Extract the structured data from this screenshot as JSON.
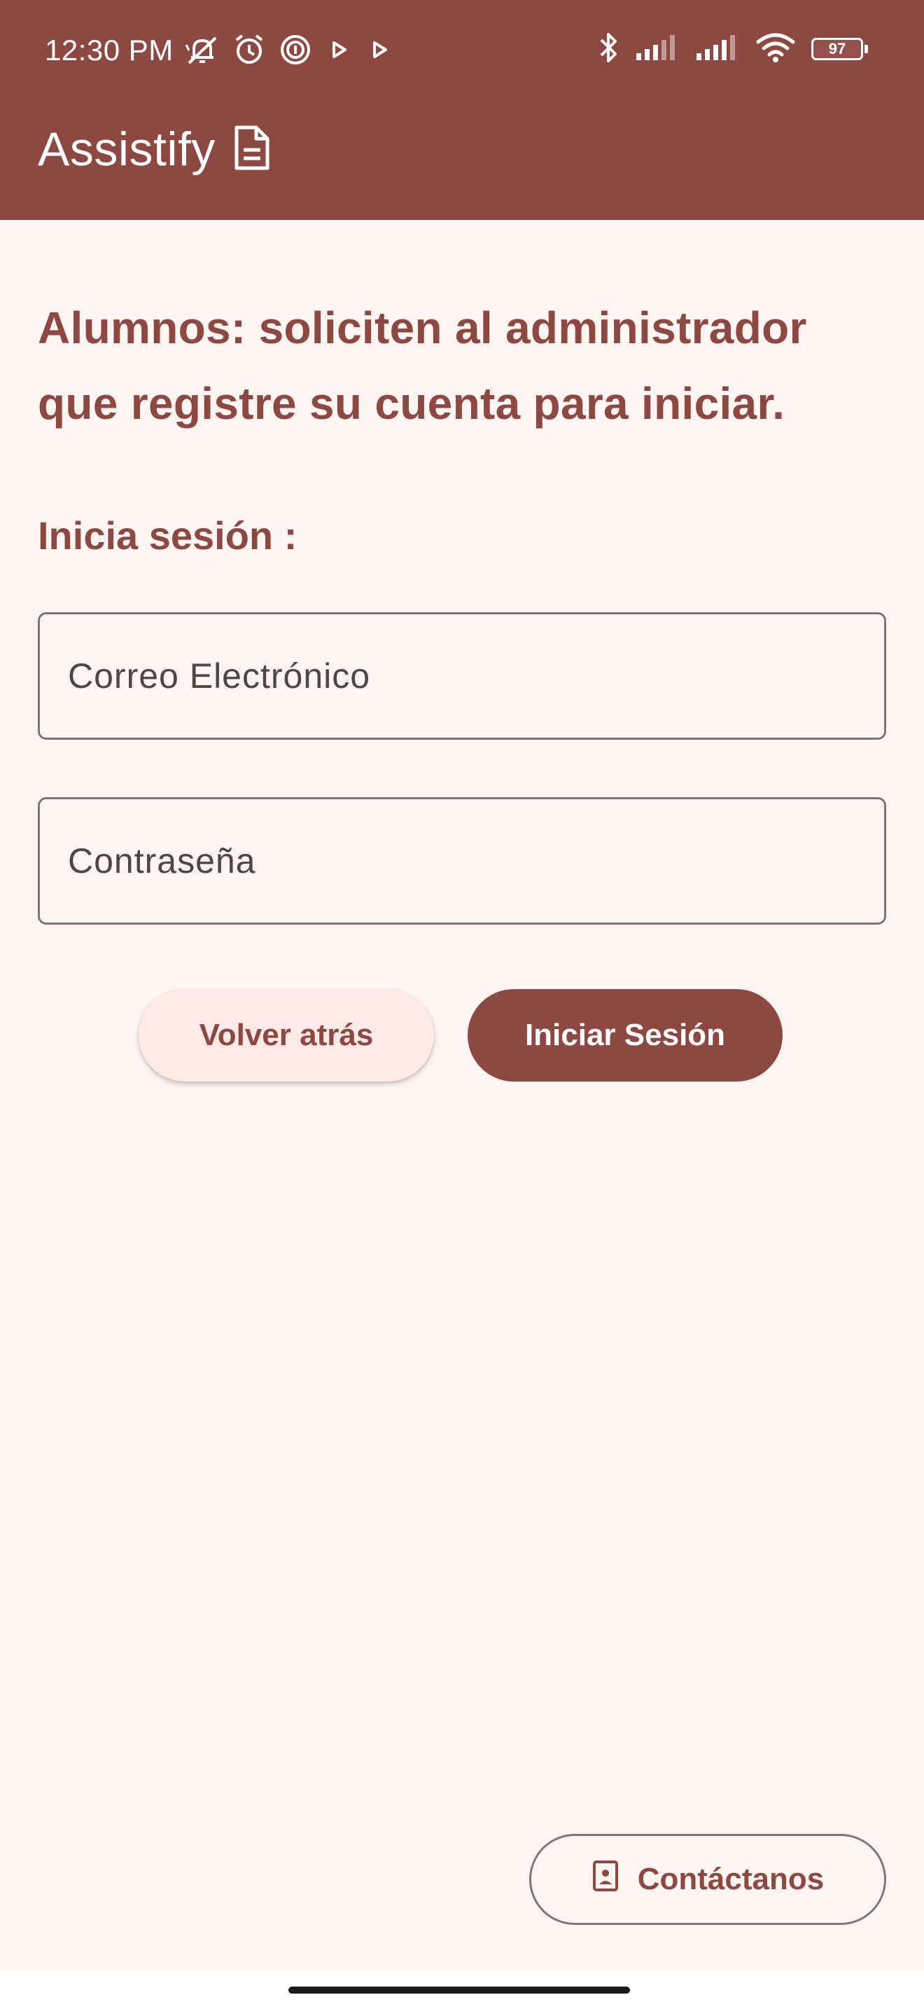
{
  "colors": {
    "primary": "#8e4842",
    "background": "#fff5f3",
    "on_primary": "#ffffff",
    "outline": "#857371",
    "secondary_container": "#fdeae6"
  },
  "status_bar": {
    "time": "12:30 PM",
    "left_icons": [
      "muted-notifications-icon",
      "alarm-icon",
      "app-notification-icon",
      "play-icon",
      "play-icon"
    ],
    "right_icons": [
      "bluetooth-icon",
      "signal-icon",
      "signal-icon",
      "wifi-icon",
      "battery-icon"
    ],
    "battery": "97"
  },
  "app_bar": {
    "title": "Assistify",
    "icon": "document-icon"
  },
  "main": {
    "headline": "Alumnos: soliciten al administrador que registre su cuenta para iniciar.",
    "login_label": "Inicia sesión :",
    "email_placeholder": "Correo Electrónico",
    "password_placeholder": "Contraseña",
    "back_button": "Volver atrás",
    "login_button": "Iniciar Sesión"
  },
  "contact_button": {
    "label": "Contáctanos",
    "icon": "contact-card-icon"
  }
}
